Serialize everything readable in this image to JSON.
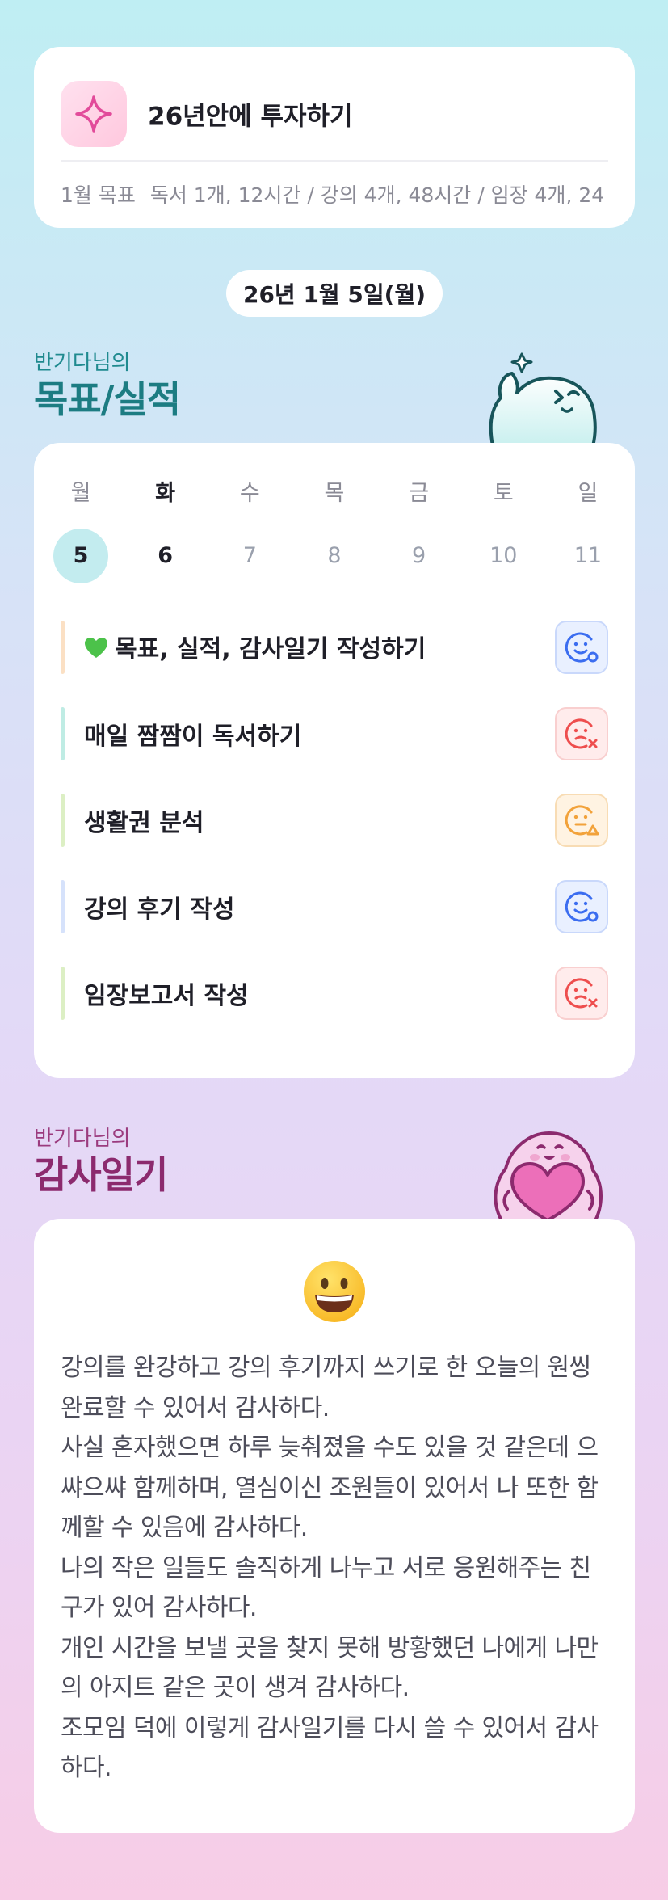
{
  "goal": {
    "title": "26년안에 투자하기",
    "month_label": "1월 목표",
    "summary": "독서 1개, 12시간 / 강의 4개, 48시간 / 임장 4개, 24"
  },
  "date_pill": "26년 1월 5일(월)",
  "goals_section": {
    "subtitle": "반기다님의",
    "title": "목표/실적"
  },
  "week": {
    "weekdays": [
      "월",
      "화",
      "수",
      "목",
      "금",
      "토",
      "일"
    ],
    "days": [
      "5",
      "6",
      "7",
      "8",
      "9",
      "10",
      "11"
    ]
  },
  "tasks": [
    {
      "label": "목표, 실적, 감사일기 작성하기",
      "status_icon": "smile-check-icon",
      "bar_color": "#fbe0c4"
    },
    {
      "label": "매일 짬짬이 독서하기",
      "status_icon": "sad-x-icon",
      "bar_color": "#bfece4"
    },
    {
      "label": "생활권 분석",
      "status_icon": "neutral-warning-icon",
      "bar_color": "#dcefc4"
    },
    {
      "label": "강의 후기 작성",
      "status_icon": "smile-check-icon",
      "bar_color": "#d6e2fb"
    },
    {
      "label": "임장보고서 작성",
      "status_icon": "sad-x-icon",
      "bar_color": "#dcefc4"
    }
  ],
  "diary_section": {
    "subtitle": "반기다님의",
    "title": "감사일기"
  },
  "diary": {
    "emoji": "grinning-face-icon",
    "paragraphs": [
      "강의를 완강하고 강의 후기까지 쓰기로 한 오늘의 원씽 완료할 수 있어서 감사하다.",
      "사실 혼자했으면 하루 늦춰졌을 수도 있을 것 같은데 으쌰으쌰 함께하며, 열심이신 조원들이 있어서 나 또한 함께할 수 있음에 감사하다.",
      "나의 작은 일들도 솔직하게 나누고 서로 응원해주는 친구가 있어 감사하다.",
      "개인 시간을 보낼 곳을 찾지 못해 방황했던 나에게 나만의 아지트 같은 곳이 생겨 감사하다.",
      "조모임 덕에 이렇게 감사일기를 다시 쓸 수 있어서 감사하다."
    ]
  },
  "colors": {
    "accent_teal": "#1c7c82",
    "accent_plum": "#8c2a6e",
    "today_circle": "#c3ecef",
    "status_blue": "#3b6df0",
    "status_red": "#ee4e4e",
    "status_orange": "#f2a23a"
  }
}
